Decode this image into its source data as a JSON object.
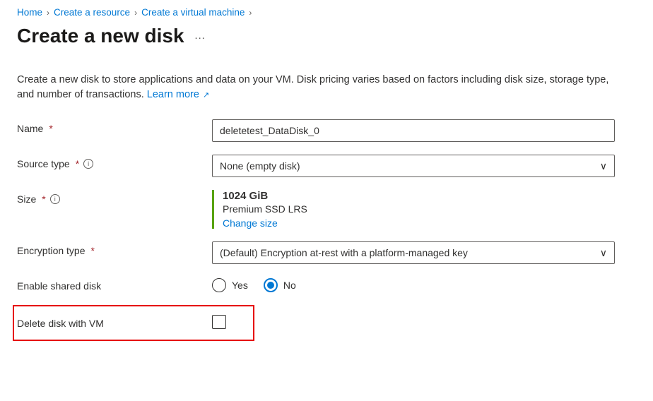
{
  "breadcrumb": {
    "home": "Home",
    "create_resource": "Create a resource",
    "create_vm": "Create a virtual machine"
  },
  "page_title": "Create a new disk",
  "description": {
    "text": "Create a new disk to store applications and data on your VM. Disk pricing varies based on factors including disk size, storage type, and number of transactions.",
    "learn_more": "Learn more"
  },
  "fields": {
    "name": {
      "label": "Name",
      "value": "deletetest_DataDisk_0"
    },
    "source_type": {
      "label": "Source type",
      "value": "None (empty disk)"
    },
    "size": {
      "label": "Size",
      "value": "1024 GiB",
      "type_text": "Premium SSD LRS",
      "change_link": "Change size"
    },
    "encryption": {
      "label": "Encryption type",
      "value": "(Default) Encryption at-rest with a platform-managed key"
    },
    "shared": {
      "label": "Enable shared disk",
      "yes": "Yes",
      "no": "No",
      "selected": "no"
    },
    "delete_with_vm": {
      "label": "Delete disk with VM",
      "checked": false
    }
  }
}
